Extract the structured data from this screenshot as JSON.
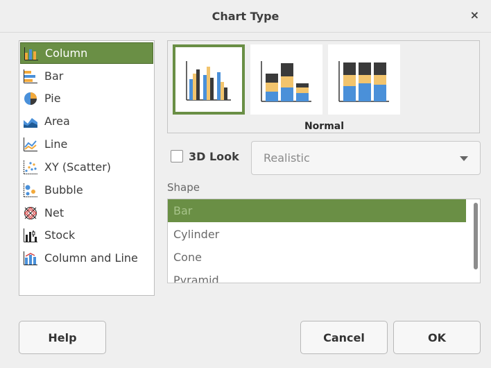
{
  "window": {
    "title": "Chart Type",
    "close_glyph": "×"
  },
  "chart_types": [
    {
      "label": "Column",
      "icon": "column-chart-icon",
      "selected": true
    },
    {
      "label": "Bar",
      "icon": "bar-chart-icon",
      "selected": false
    },
    {
      "label": "Pie",
      "icon": "pie-chart-icon",
      "selected": false
    },
    {
      "label": "Area",
      "icon": "area-chart-icon",
      "selected": false
    },
    {
      "label": "Line",
      "icon": "line-chart-icon",
      "selected": false
    },
    {
      "label": "XY (Scatter)",
      "icon": "scatter-chart-icon",
      "selected": false
    },
    {
      "label": "Bubble",
      "icon": "bubble-chart-icon",
      "selected": false
    },
    {
      "label": "Net",
      "icon": "net-chart-icon",
      "selected": false
    },
    {
      "label": "Stock",
      "icon": "stock-chart-icon",
      "selected": false
    },
    {
      "label": "Column and Line",
      "icon": "column-line-chart-icon",
      "selected": false
    }
  ],
  "variants": {
    "selected_name": "Normal",
    "items": [
      {
        "id": "normal",
        "selected": true
      },
      {
        "id": "stacked",
        "selected": false
      },
      {
        "id": "percent-stacked",
        "selected": false
      }
    ]
  },
  "look3d": {
    "label": "3D Look",
    "checked": false,
    "style_value": "Realistic"
  },
  "shape": {
    "label": "Shape",
    "items": [
      {
        "label": "Bar",
        "selected": true
      },
      {
        "label": "Cylinder",
        "selected": false
      },
      {
        "label": "Cone",
        "selected": false
      },
      {
        "label": "Pyramid",
        "selected": false
      }
    ]
  },
  "buttons": {
    "help": "Help",
    "cancel": "Cancel",
    "ok": "OK"
  },
  "colors": {
    "accent": "#6a8f45",
    "series_blue": "#4a90d9",
    "series_orange": "#f2c46d",
    "series_dark": "#3a3a3a"
  }
}
